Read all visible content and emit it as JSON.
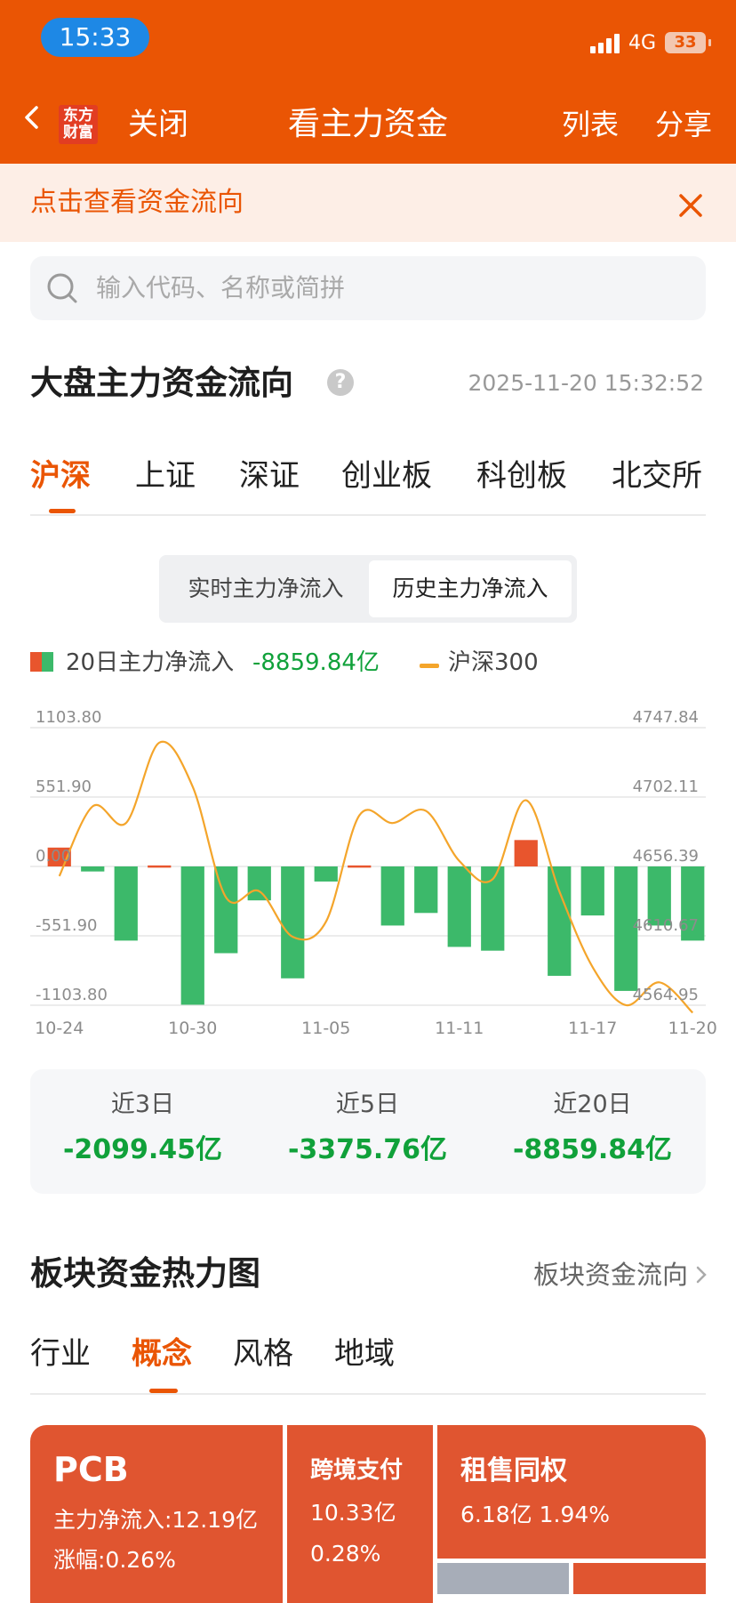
{
  "status_bar": {
    "time": "15:33",
    "network": "4G",
    "battery": "33"
  },
  "nav": {
    "brand_line1": "东方",
    "brand_line2": "财富",
    "close": "关闭",
    "title": "看主力资金",
    "list": "列表",
    "share": "分享"
  },
  "notice": {
    "text": "点击查看资金流向"
  },
  "search": {
    "placeholder": "输入代码、名称或简拼"
  },
  "main_flow": {
    "title": "大盘主力资金流向",
    "help": "?",
    "timestamp": "2025-11-20 15:32:52",
    "tabs": [
      "沪深",
      "上证",
      "深证",
      "创业板",
      "科创板",
      "北交所"
    ],
    "active_tab": 0,
    "segments": [
      "实时主力净流入",
      "历史主力净流入"
    ],
    "active_segment": 1,
    "legend": {
      "bar_label": "20日主力净流入",
      "bar_value": "-8859.84亿",
      "line_label": "沪深300"
    }
  },
  "chart_data": {
    "type": "bar",
    "colors": {
      "inflow": "#e8552d",
      "outflow": "#3cb96a",
      "index_line": "#f4a52b",
      "grid": "#e6e6e6"
    },
    "left_axis": {
      "ylim": [
        -1103.8,
        1103.8
      ],
      "ticks": [
        "1103.80",
        "551.90",
        "0.00",
        "-551.90",
        "-1103.80"
      ]
    },
    "right_axis": {
      "ylim": [
        4564.95,
        4747.84
      ],
      "ticks": [
        "4747.84",
        "4702.11",
        "4656.39",
        "4610.67",
        "4564.95"
      ]
    },
    "x_labels": [
      "10-24",
      "10-30",
      "11-05",
      "11-11",
      "11-17",
      "11-20"
    ],
    "bars": [
      {
        "value": 150
      },
      {
        "value": -40
      },
      {
        "value": -590
      },
      {
        "value": 8
      },
      {
        "value": -1100
      },
      {
        "value": -690
      },
      {
        "value": -270
      },
      {
        "value": -890
      },
      {
        "value": -120
      },
      {
        "value": 8
      },
      {
        "value": -470
      },
      {
        "value": -370
      },
      {
        "value": -640
      },
      {
        "value": -670
      },
      {
        "value": 210
      },
      {
        "value": -870
      },
      {
        "value": -390
      },
      {
        "value": -990
      },
      {
        "value": -470
      },
      {
        "value": -590
      }
    ],
    "bar_label_index": {
      "0": "10-24",
      "4": "10-30",
      "8": "11-05",
      "12": "11-11",
      "16": "11-17",
      "19": "11-20"
    },
    "index_series": {
      "name": "沪深300",
      "values": [
        4650,
        4696,
        4685,
        4738,
        4709,
        4636,
        4640,
        4610,
        4620,
        4690,
        4685,
        4693,
        4660,
        4648,
        4700,
        4640,
        4590,
        4565,
        4580,
        4560
      ]
    }
  },
  "summary": [
    {
      "label": "近3日",
      "value": "-2099.45亿"
    },
    {
      "label": "近5日",
      "value": "-3375.76亿"
    },
    {
      "label": "近20日",
      "value": "-8859.84亿"
    }
  ],
  "heatmap": {
    "title": "板块资金热力图",
    "link": "板块资金流向",
    "tabs": [
      "行业",
      "概念",
      "风格",
      "地域"
    ],
    "active_tab": 1,
    "tiles": [
      {
        "name": "PCB",
        "line1": "主力净流入:12.19亿",
        "line2": "涨幅:0.26%",
        "color": "#e05530"
      },
      {
        "name": "跨境支付",
        "line1": "10.33亿",
        "line2": "0.28%",
        "color": "#e05530"
      },
      {
        "name": "租售同权",
        "line1": "6.18亿  1.94%",
        "color": "#e05530"
      }
    ]
  }
}
